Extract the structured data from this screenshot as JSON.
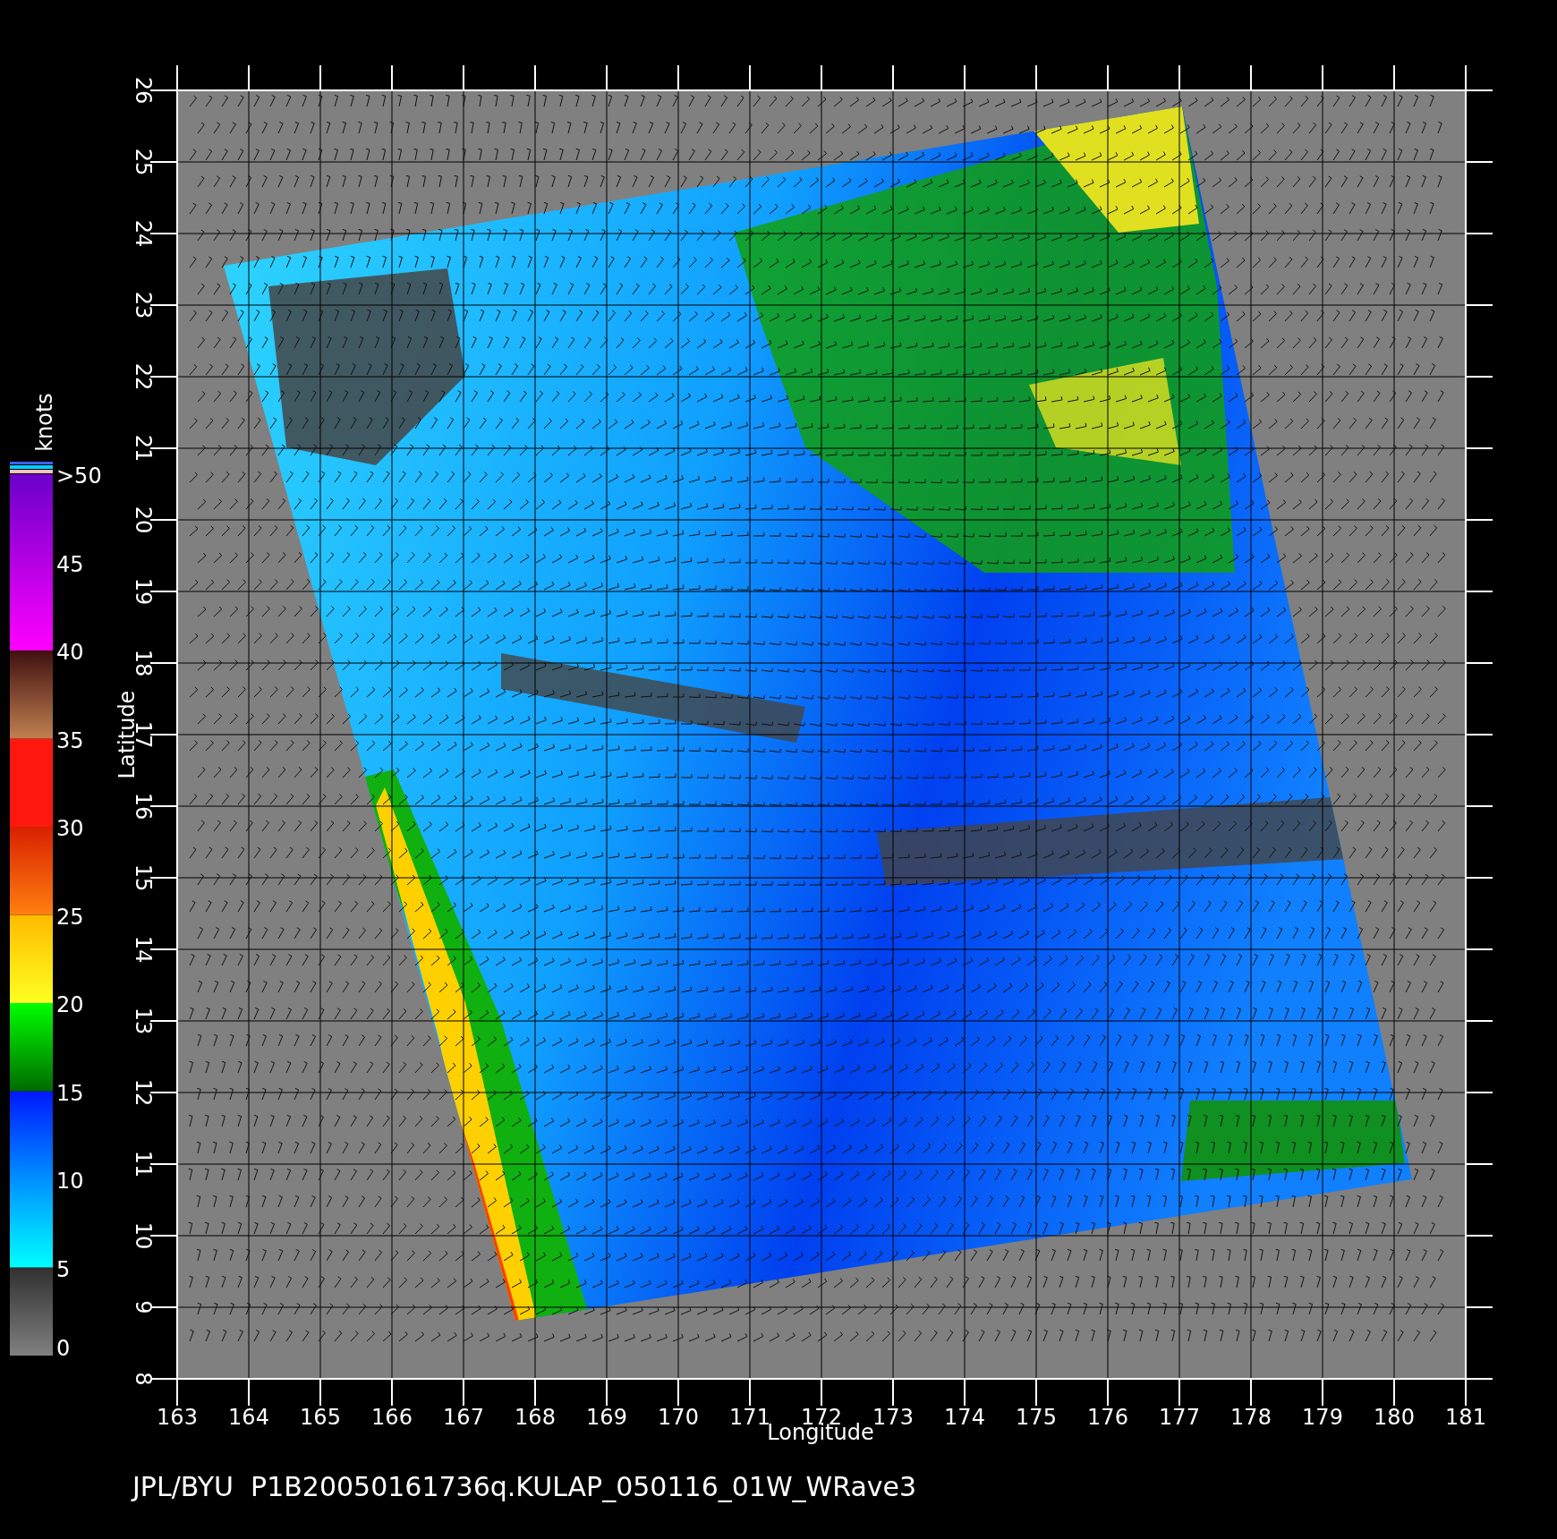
{
  "plot": {
    "xlabel": "Longitude",
    "ylabel": "Latitude",
    "xticks": [
      "163",
      "164",
      "165",
      "166",
      "167",
      "168",
      "169",
      "170",
      "171",
      "172",
      "173",
      "174",
      "175",
      "176",
      "177",
      "178",
      "179",
      "180",
      "181"
    ],
    "yticks": [
      "8",
      "9",
      "10",
      "11",
      "12",
      "13",
      "14",
      "15",
      "16",
      "17",
      "18",
      "19",
      "20",
      "21",
      "22",
      "23",
      "24",
      "25",
      "26"
    ]
  },
  "colorbar": {
    "title": "knots",
    "labels": [
      ">50",
      "45",
      "40",
      "35",
      "30",
      "25",
      "20",
      "15",
      "10",
      "5",
      "0"
    ]
  },
  "caption": "JPL/BYU  P1B20050161736q.KULAP_050116_01W_WRave3"
}
